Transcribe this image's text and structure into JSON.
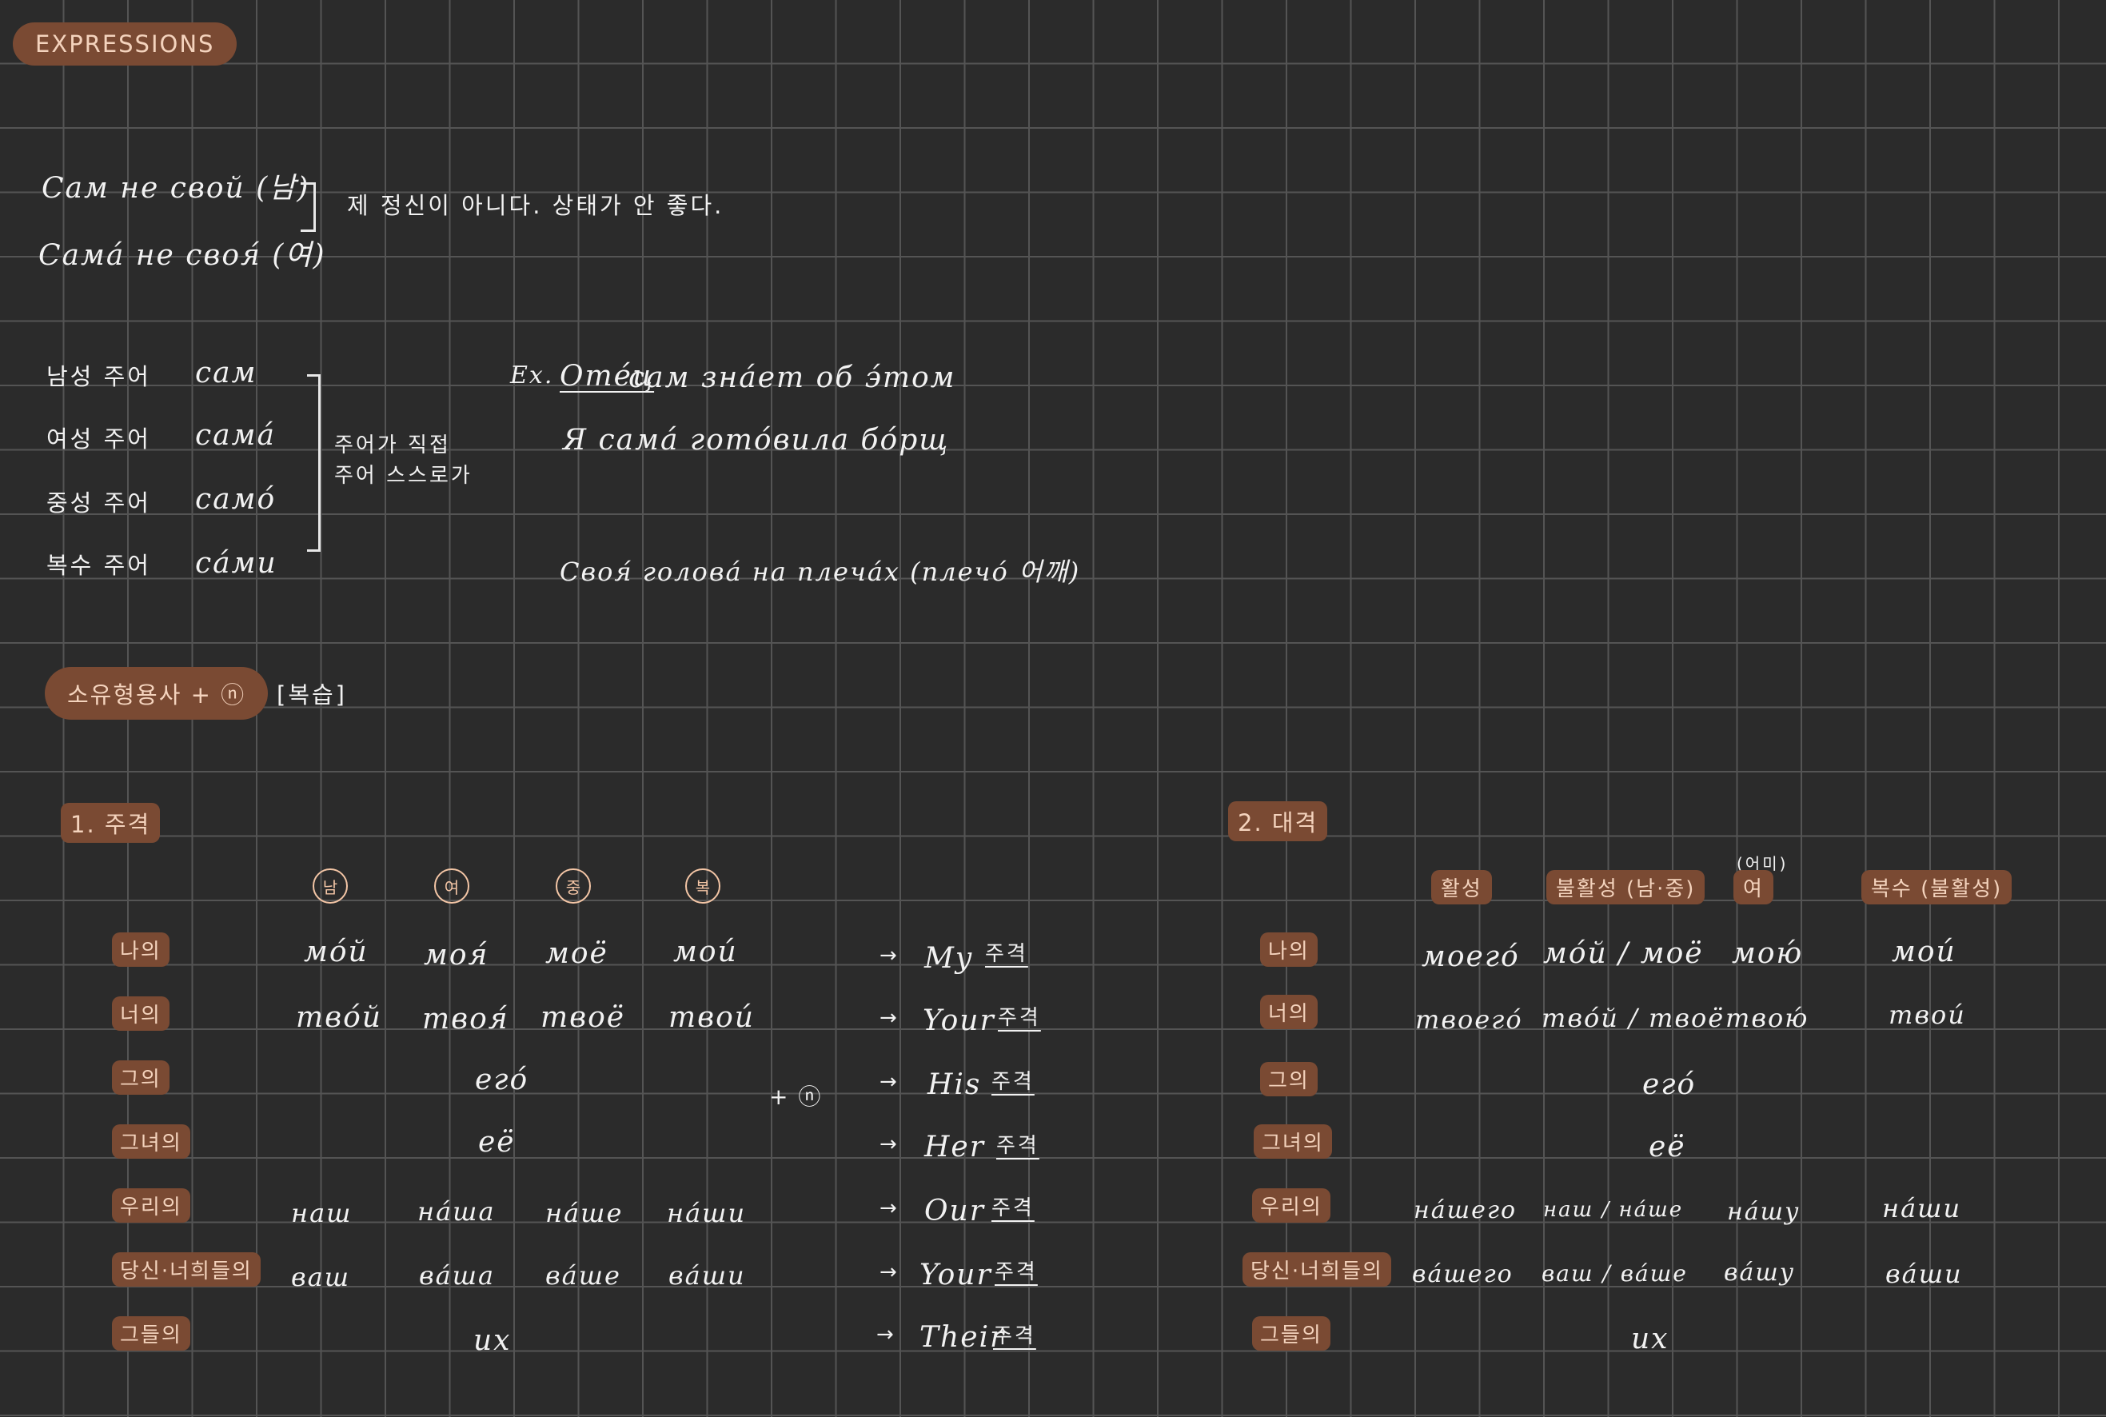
{
  "header": {
    "badge": "EXPRESSIONS"
  },
  "expressions": {
    "masc": "Сам не свой (남)",
    "fem": "Сама́ не своя́ (여)",
    "meaning": "제 정신이 아니다. 상태가 안 좋다."
  },
  "sam_forms": {
    "rows": [
      {
        "label": "남성 주어",
        "form": "сам"
      },
      {
        "label": "여성 주어",
        "form": "сама́"
      },
      {
        "label": "중성 주어",
        "form": "само́"
      },
      {
        "label": "복수 주어",
        "form": "са́ми"
      }
    ],
    "note_line1": "주어가 직접",
    "note_line2": "주어 스스로가",
    "example_prefix": "Ex.",
    "example_underlined": "Оте́ц",
    "example1_rest": "сам зна́ет об э́том",
    "example2": "Я сама́ гото́вила бо́рщ",
    "example3": "Своя́ голова́ на плеча́х (плечо́ 어깨)"
  },
  "possessive": {
    "badge": "소유형용사 + ⓝ",
    "review": "[복습]",
    "nominative": {
      "title": "1. 주격",
      "gender_headers": [
        "남",
        "여",
        "중",
        "복"
      ],
      "rows": [
        {
          "label": "나의",
          "forms": [
            "мо́й",
            "моя́",
            "моё",
            "мои́"
          ]
        },
        {
          "label": "너의",
          "forms": [
            "тво́й",
            "твоя́",
            "твоё",
            "твои́"
          ]
        },
        {
          "label": "그의",
          "single": "его́"
        },
        {
          "label": "그녀의",
          "single": "её"
        },
        {
          "label": "우리의",
          "forms": [
            "наш",
            "на́ша",
            "на́ше",
            "на́ши"
          ]
        },
        {
          "label": "당신·너희들의",
          "forms": [
            "ваш",
            "ва́ша",
            "ва́ше",
            "ва́ши"
          ]
        },
        {
          "label": "그들의",
          "single": "их"
        }
      ],
      "plus_n": "+ ⓝ",
      "english": [
        "My",
        "Your",
        "His",
        "Her",
        "Our",
        "Your",
        "Their"
      ],
      "case_word": "주격"
    },
    "accusative": {
      "title": "2. 대격",
      "col_headers": [
        "활성",
        "불활성 (남·중)",
        "여",
        "복수 (불활성)"
      ],
      "fem_note": "(어미)",
      "rows": [
        {
          "label": "나의",
          "forms": [
            "моего́",
            "мо́й / моё",
            "мою́",
            "мои́"
          ]
        },
        {
          "label": "너의",
          "forms": [
            "твоего́",
            "тво́й / твоё",
            "твою́",
            "твои́"
          ]
        },
        {
          "label": "그의",
          "single": "его́"
        },
        {
          "label": "그녀의",
          "single": "её"
        },
        {
          "label": "우리의",
          "forms": [
            "на́шего",
            "наш / на́ше",
            "на́шу",
            "на́ши"
          ]
        },
        {
          "label": "당신·너희들의",
          "forms": [
            "ва́шего",
            "ваш / ва́ше",
            "ва́шу",
            "ва́ши"
          ]
        },
        {
          "label": "그들의",
          "single": "их"
        }
      ]
    }
  }
}
